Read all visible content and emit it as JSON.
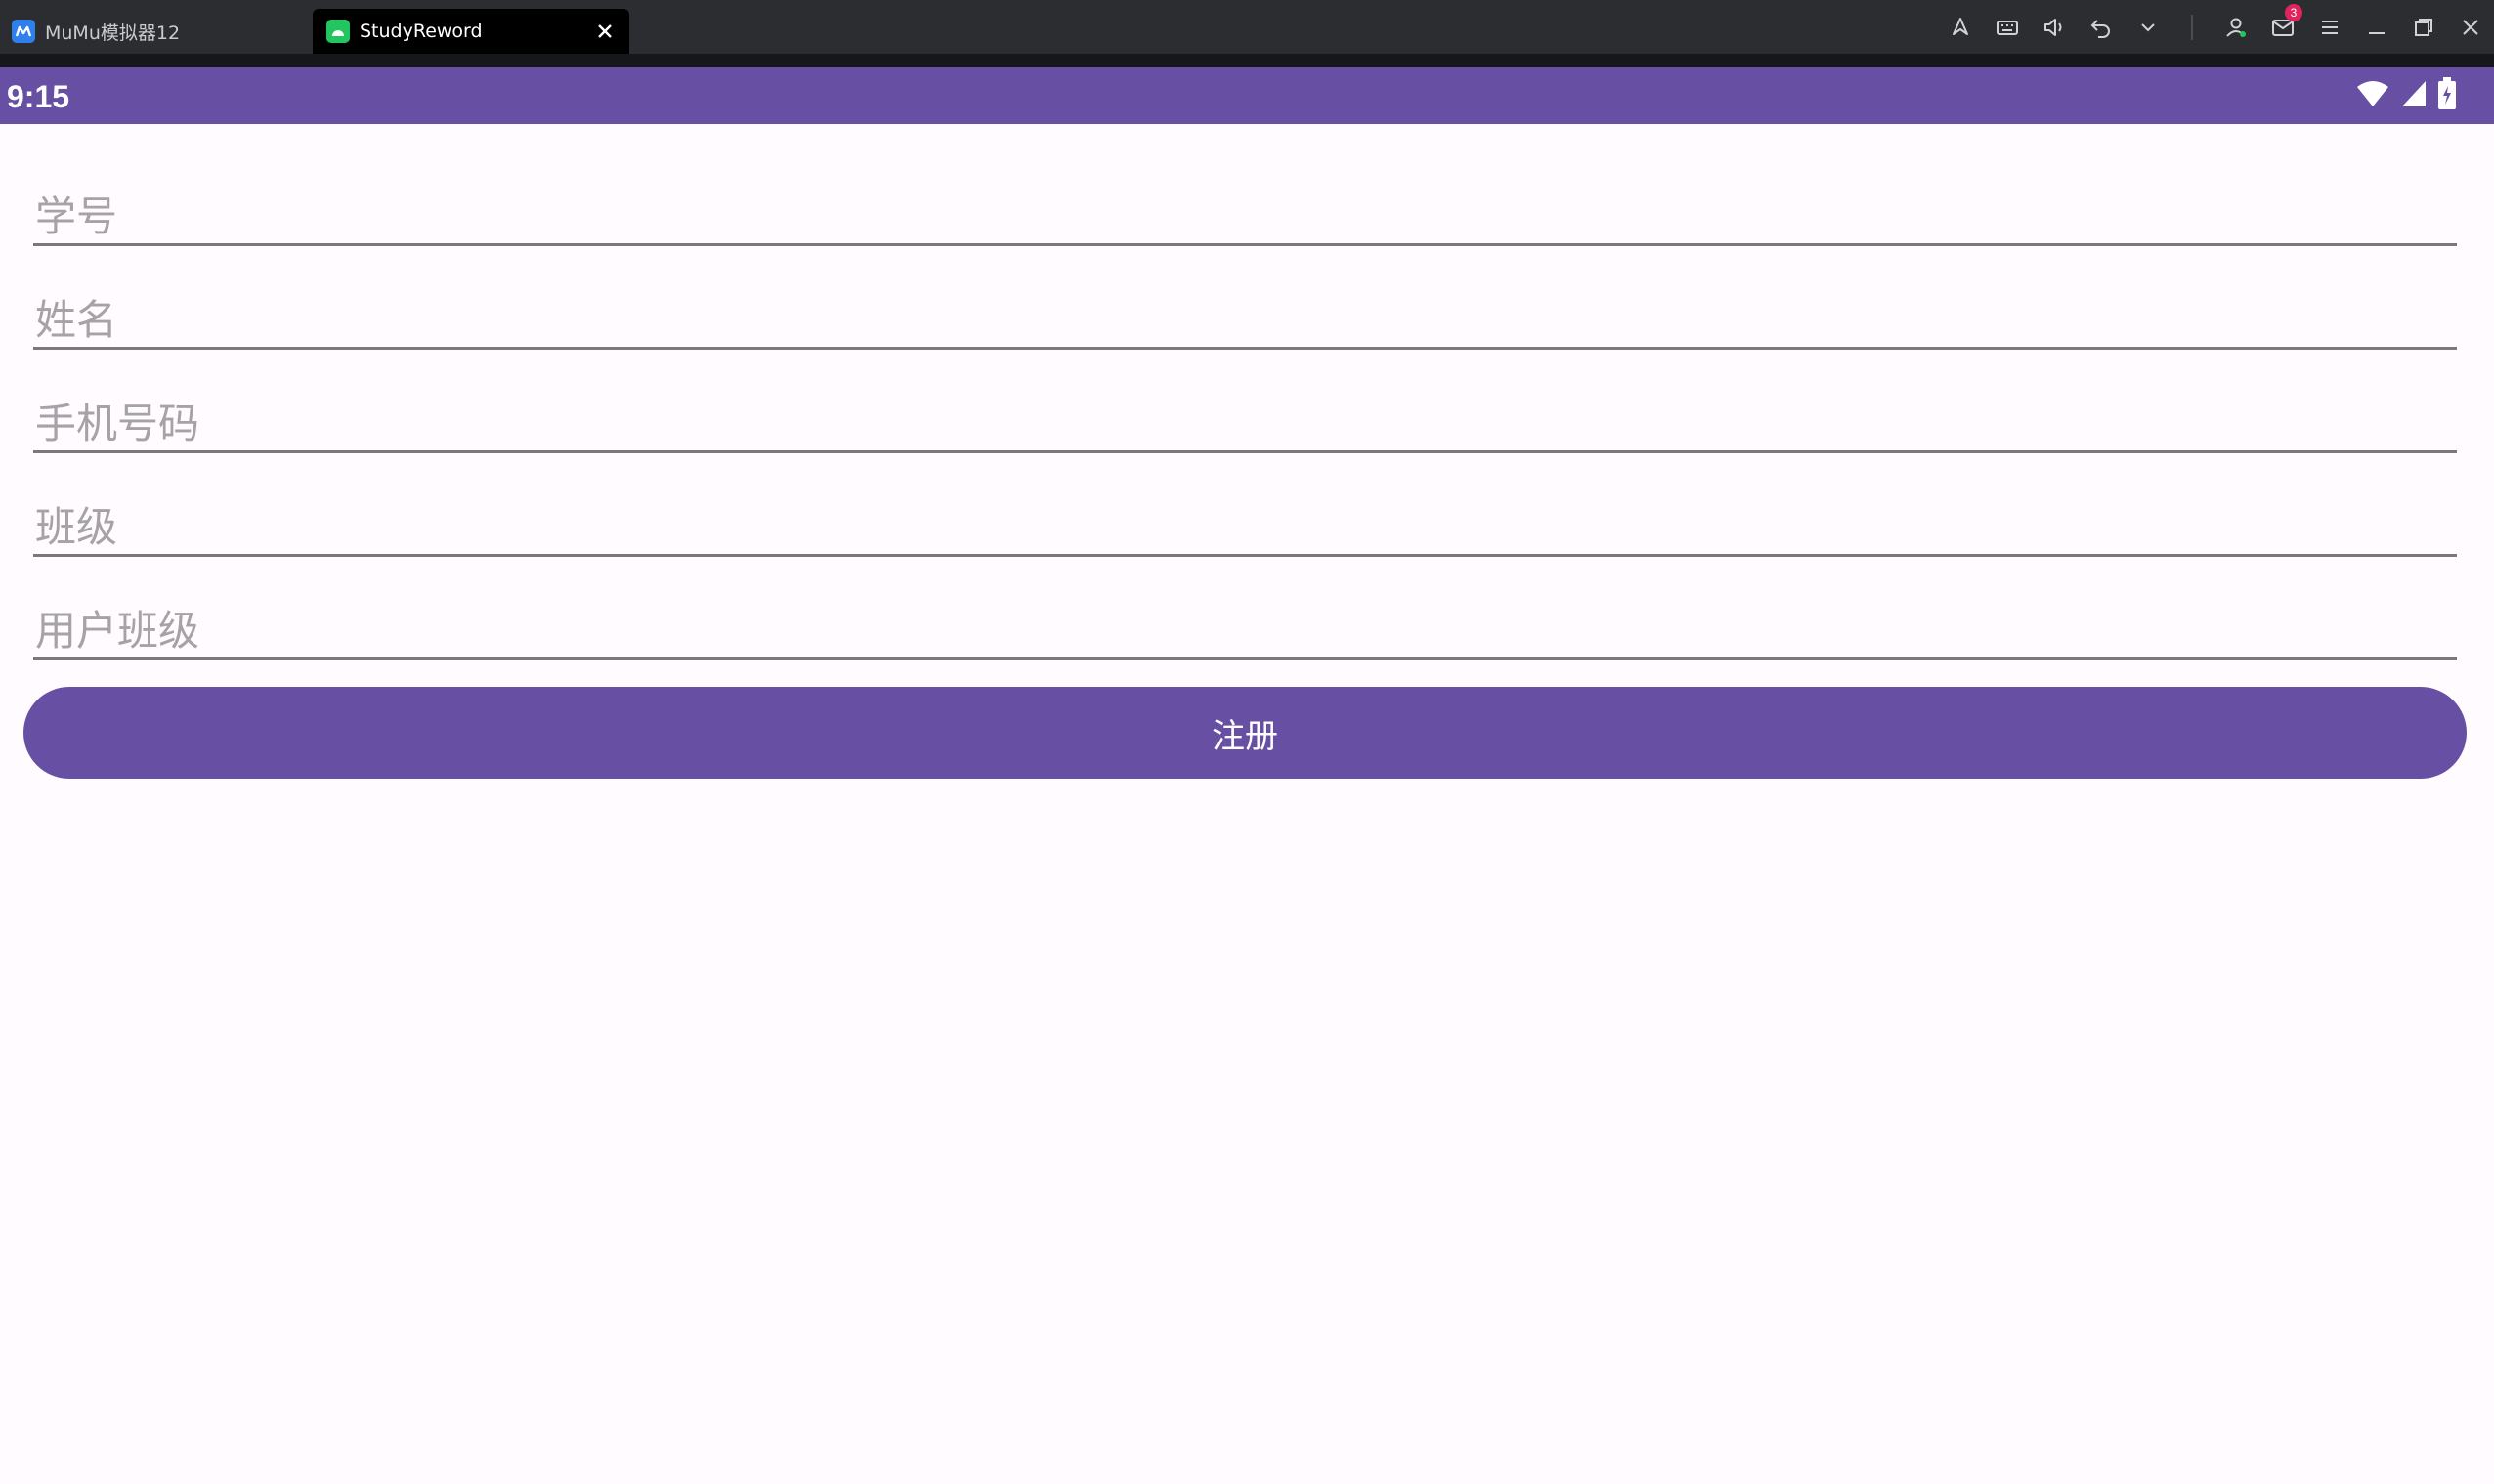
{
  "window": {
    "tabs": [
      {
        "label": "MuMu模拟器12"
      },
      {
        "label": "StudyReword"
      }
    ],
    "notification_count": "3"
  },
  "statusbar": {
    "time": "9:15"
  },
  "form": {
    "fields": [
      {
        "placeholder": "学号",
        "value": ""
      },
      {
        "placeholder": "姓名",
        "value": ""
      },
      {
        "placeholder": "手机号码",
        "value": ""
      },
      {
        "placeholder": "班级",
        "value": ""
      },
      {
        "placeholder": "用户班级",
        "value": ""
      }
    ],
    "submit_label": "注册"
  },
  "colors": {
    "primary": "#6750A4",
    "background": "#FFFBFE",
    "titlebar": "#2B2D31"
  },
  "icons": {
    "toolbar": [
      "location-pin-icon",
      "keyboard-icon",
      "volume-icon",
      "undo-icon",
      "chevron-down-icon",
      "user-icon",
      "mail-icon",
      "menu-icon",
      "minimize-icon",
      "restore-icon",
      "close-icon"
    ],
    "status": [
      "wifi-icon",
      "signal-icon",
      "battery-icon"
    ]
  }
}
